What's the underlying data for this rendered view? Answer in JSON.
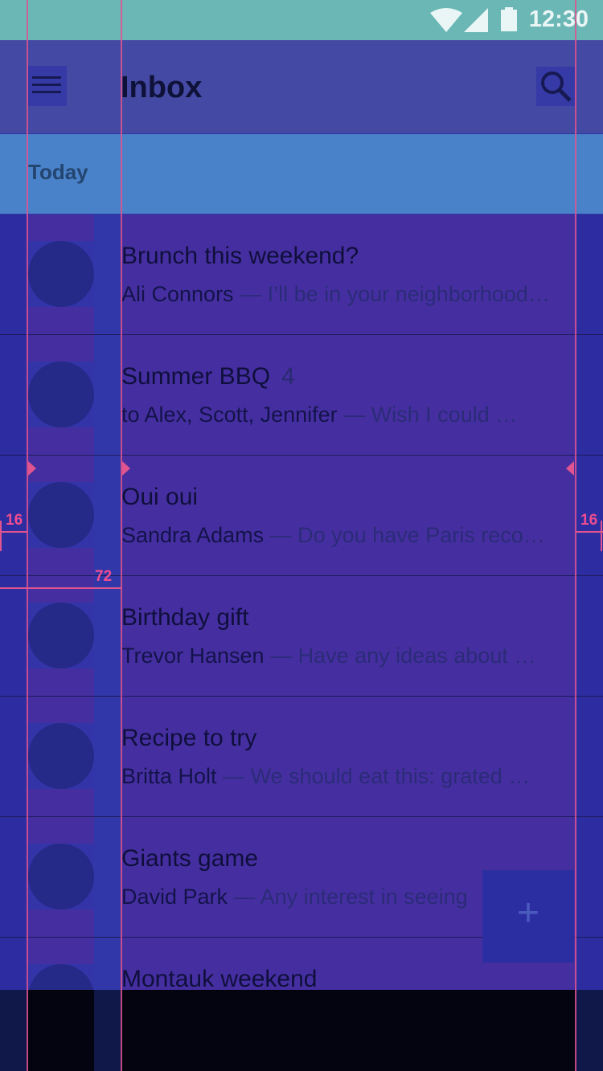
{
  "status_bar": {
    "time": "12:30"
  },
  "app_bar": {
    "title": "Inbox"
  },
  "subheader": {
    "label": "Today"
  },
  "keylines": {
    "margin_left": "16",
    "margin_right": "16",
    "content_inset": "72"
  },
  "emails": [
    {
      "subject": "Brunch this weekend?",
      "count": "",
      "sender": "Ali Connors",
      "snippet": "I’ll be in your neighborhood…"
    },
    {
      "subject": "Summer BBQ",
      "count": "4",
      "sender": "to Alex, Scott, Jennifer",
      "snippet": "Wish I could …"
    },
    {
      "subject": "Oui oui",
      "count": "",
      "sender": "Sandra Adams",
      "snippet": "Do you have Paris reco…"
    },
    {
      "subject": "Birthday gift",
      "count": "",
      "sender": "Trevor Hansen",
      "snippet": "Have any ideas about …"
    },
    {
      "subject": "Recipe to try",
      "count": "",
      "sender": "Britta Holt",
      "snippet": "We should eat this: grated …"
    },
    {
      "subject": "Giants game",
      "count": "",
      "sender": "David Park",
      "snippet": "Any interest in seeing"
    },
    {
      "subject": "Montauk weekend",
      "count": "",
      "sender": "",
      "snippet": ""
    }
  ],
  "fab": {
    "icon": "plus-icon"
  },
  "colors": {
    "accent": "#e0548f",
    "list_bg": "#452fa0",
    "appbar": "#4449a3"
  }
}
